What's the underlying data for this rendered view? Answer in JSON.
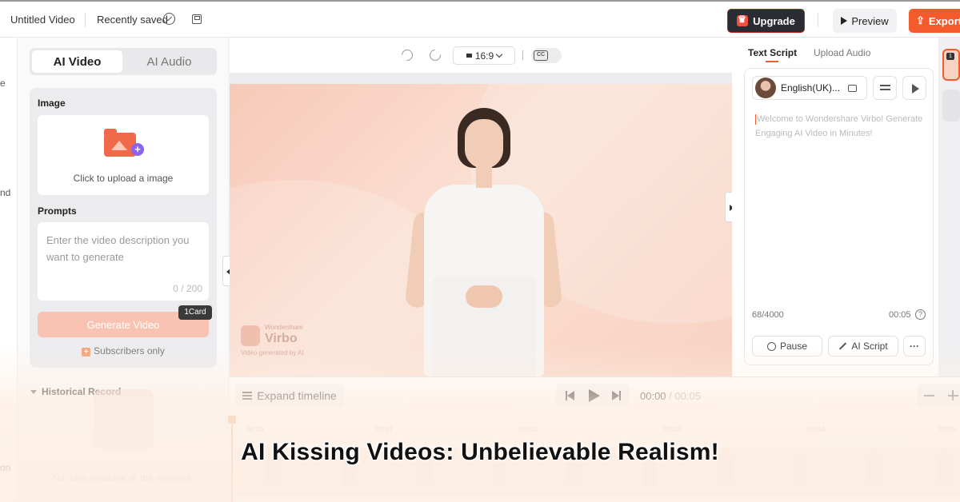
{
  "topbar": {
    "title": "Untitled Video",
    "saved_status": "Recently saved",
    "upgrade_label": "Upgrade",
    "preview_label": "Preview",
    "export_label": "Export"
  },
  "leftstrip": {
    "fragments": [
      "e",
      "nd",
      "on"
    ]
  },
  "leftpanel": {
    "tabs": [
      {
        "label": "AI Video",
        "active": true
      },
      {
        "label": "AI Audio",
        "active": false
      }
    ],
    "image_label": "Image",
    "upload_text": "Click to upload a image",
    "prompts_label": "Prompts",
    "prompt_placeholder": "Enter the video description you want to generate",
    "prompt_count": "0 / 200",
    "generate_label": "Generate Video",
    "card_badge": "1Card",
    "subscribers_text": "Subscribers only",
    "history_label": "Historical Record",
    "no_data_text": "No data available at the moment."
  },
  "canvas": {
    "aspect_ratio": "16:9",
    "cc_label": "CC",
    "watermark_brand": "Wondershare",
    "watermark_name": "Virbo",
    "watermark_sub": "Video generated by AI"
  },
  "scriptpanel": {
    "tabs": [
      "Text Script",
      "Upload Audio"
    ],
    "voice_name": "English(UK)...",
    "script_text": "Welcome to Wondershare Virbo! Generate Engaging AI Video in Minutes!",
    "char_count": "68/4000",
    "duration": "00:05",
    "help_icon": "?",
    "pause_label": "Pause",
    "ai_script_label": "AI Script",
    "more_label": "···"
  },
  "rightstrip": {
    "scene_number": "1"
  },
  "timeline": {
    "expand_label": "Expand timeline",
    "current_time": "00:00",
    "total_time": " / 00:05",
    "ruler_ticks": [
      "00:00",
      "00:01",
      "00:02",
      "00:03",
      "00:04",
      "00:05"
    ]
  },
  "headline": "AI Kissing Videos: Unbelievable Realism!",
  "colors": {
    "accent": "#f35a2c",
    "upgrade_bg": "#2b2b33",
    "stage_bg": "#f7c9b8"
  }
}
